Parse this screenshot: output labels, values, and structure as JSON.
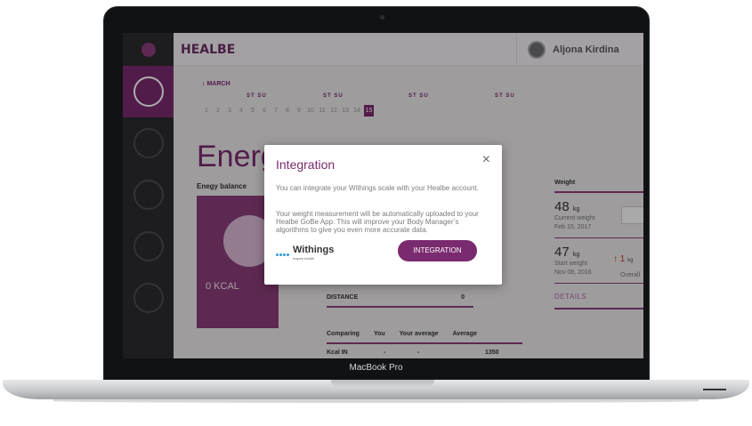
{
  "device": {
    "label": "MacBook Pro"
  },
  "app": {
    "title": "HEALBE",
    "user": {
      "name": "Aljona Kirdina"
    }
  },
  "calendar": {
    "month": "↕ MARCH",
    "week_labels": [
      "ST",
      "SU"
    ],
    "days": [
      "1",
      "2",
      "3",
      "4",
      "5",
      "6",
      "7",
      "8",
      "9",
      "10",
      "11",
      "12",
      "13",
      "14",
      "15"
    ],
    "selected_day": "15"
  },
  "main": {
    "heading": "Energy",
    "balance_label": "Enegy balance",
    "kcal": "0 KCAL",
    "distance": {
      "label": "DISTANCE",
      "value": "0"
    },
    "comparing": {
      "headers": [
        "Comparing",
        "You",
        "Your average",
        "Average"
      ],
      "rows": [
        [
          "Kcal IN",
          "-",
          "-",
          "1350"
        ]
      ]
    }
  },
  "weight": {
    "title": "Weight",
    "current": {
      "value": "48",
      "unit": "kg",
      "label": "Current weight",
      "date": "Feb 15, 2017"
    },
    "start": {
      "value": "47",
      "unit": "kg",
      "label": "Start weight",
      "date": "Nov 08, 2016"
    },
    "delta": {
      "value": "1",
      "unit": "kg",
      "label": "Overall"
    },
    "details": "DETAILS"
  },
  "modal": {
    "title": "Integration",
    "close": "×",
    "p1": "You can integrate your Withings scale with your Healbe account.",
    "p2": "Your weight measurement will be automatically uploaded to your Healbe GoBe App. This will improve your Body Manager’s algorithms to give you even more accurate data.",
    "brand": "Withings",
    "brand_tag": "Inspire health",
    "button": "INTEGRATION"
  },
  "colors": {
    "accent": "#7a2a6e",
    "sidebar": "#2b2a2d",
    "withings": "#2d9bd8"
  }
}
